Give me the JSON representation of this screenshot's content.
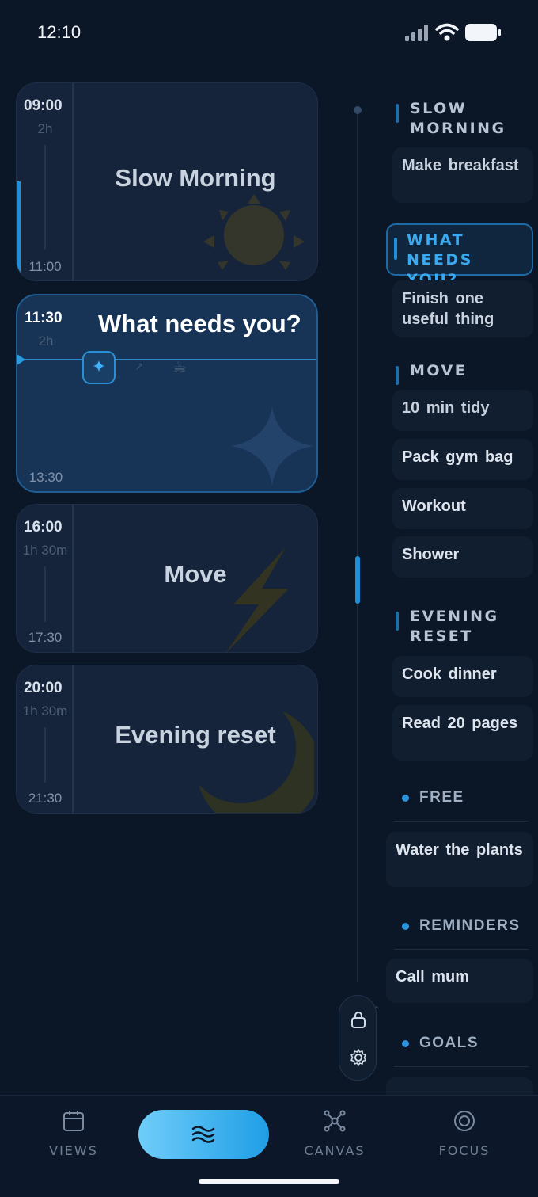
{
  "status_bar": {
    "time": "12:10"
  },
  "timeline": {
    "blocks": [
      {
        "start": "09:00",
        "duration": "2h",
        "end": "11:00",
        "title": "Slow Morning",
        "icon": "sun-icon"
      },
      {
        "start": "11:30",
        "duration": "2h",
        "end": "13:30",
        "title": "What needs you?",
        "icon": "sparkle-icon",
        "active": true
      },
      {
        "start": "16:00",
        "duration": "1h 30m",
        "end": "17:30",
        "title": "Move",
        "icon": "lightning-icon"
      },
      {
        "start": "20:00",
        "duration": "1h 30m",
        "end": "21:30",
        "title": "Evening reset",
        "icon": "moon-icon"
      }
    ],
    "active_chips": {
      "spark": "✦",
      "arrow": "↗",
      "coffee": "☕"
    }
  },
  "sidebar": {
    "sections": [
      {
        "label": "SLOW\nMORNING",
        "tasks": [
          "Make breakfast"
        ]
      },
      {
        "label": "WHAT NEEDS\nYOU?",
        "tasks": [
          "Finish one useful thing"
        ],
        "active": true
      },
      {
        "label": "MOVE",
        "tasks": [
          "10 min tidy",
          "Pack gym bag",
          "Workout",
          "Shower"
        ]
      },
      {
        "label": "EVENING\nRESET",
        "tasks": [
          "Cook dinner",
          "Read 20 pages"
        ]
      }
    ],
    "categories": [
      {
        "label": "FREE",
        "tasks": [
          "Water the plants"
        ]
      },
      {
        "label": "REMINDERS",
        "tasks": [
          "Call mum"
        ]
      },
      {
        "label": "GOALS",
        "tasks": []
      }
    ]
  },
  "bottom_nav": {
    "items": [
      {
        "label": "VIEWS",
        "icon": "calendar-icon"
      },
      {
        "label": "",
        "icon": "waves-icon",
        "active": true
      },
      {
        "label": "CANVAS",
        "icon": "canvas-icon"
      },
      {
        "label": "FOCUS",
        "icon": "focus-icon"
      }
    ]
  },
  "colors": {
    "background": "#0b1626",
    "accent": "#1f9ee6",
    "active_card": "#173457"
  }
}
